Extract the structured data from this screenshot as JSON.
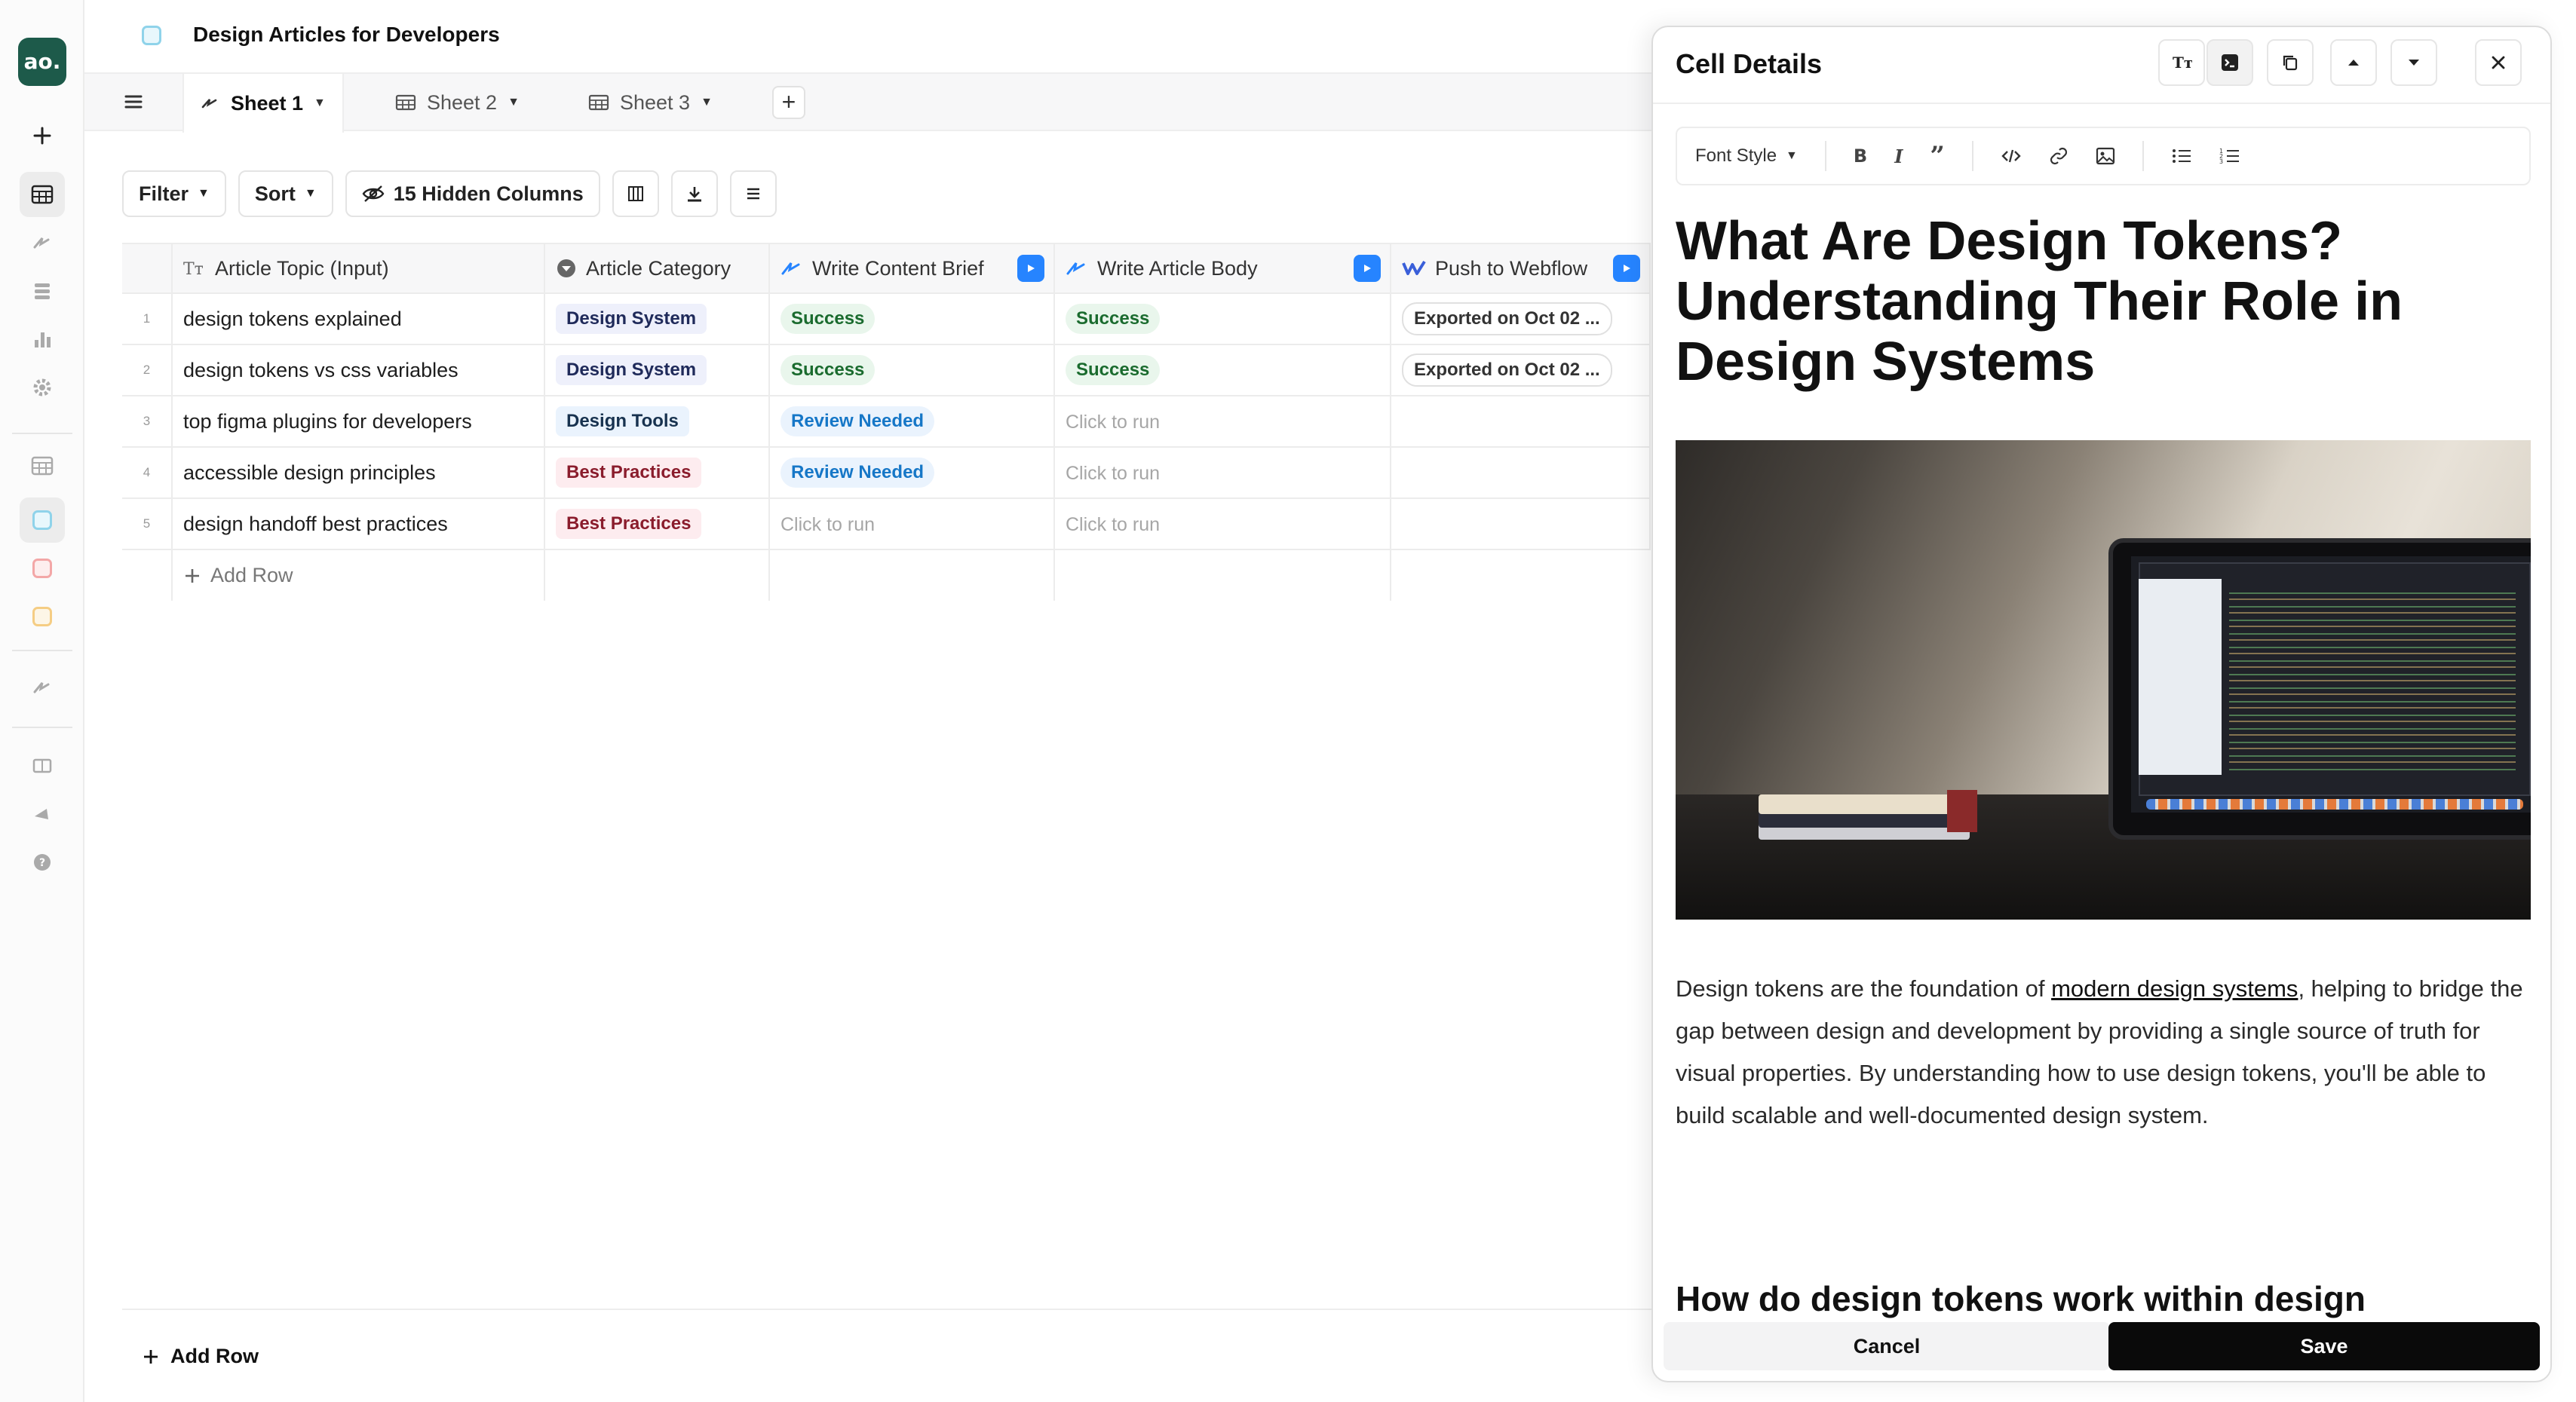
{
  "doc": {
    "title": "Design Articles for Developers"
  },
  "brand": {
    "logo_text": "ao.",
    "accent": "#1d5a4a"
  },
  "tabs": [
    {
      "label": "Sheet 1",
      "active": true
    },
    {
      "label": "Sheet 2",
      "active": false
    },
    {
      "label": "Sheet 3",
      "active": false
    }
  ],
  "toolbar": {
    "filter_label": "Filter",
    "sort_label": "Sort",
    "hidden_label": "15 Hidden Columns"
  },
  "grid": {
    "columns": [
      {
        "label": "Article Topic (Input)"
      },
      {
        "label": "Article Category"
      },
      {
        "label": "Write Content Brief"
      },
      {
        "label": "Write Article Body"
      },
      {
        "label": "Push to Webflow"
      }
    ],
    "rows": [
      {
        "n": "1",
        "topic": "design tokens explained",
        "category": "Design System",
        "brief": "Success",
        "body": "Success",
        "push": "Exported on Oct 02 ..."
      },
      {
        "n": "2",
        "topic": "design tokens vs css variables",
        "category": "Design System",
        "brief": "Success",
        "body": "Success",
        "push": "Exported on Oct 02 ..."
      },
      {
        "n": "3",
        "topic": "top figma plugins for developers",
        "category": "Design Tools",
        "brief": "Review Needed",
        "body": "Click to run",
        "push": ""
      },
      {
        "n": "4",
        "topic": "accessible design principles",
        "category": "Best Practices",
        "brief": "Review Needed",
        "body": "Click to run",
        "push": ""
      },
      {
        "n": "5",
        "topic": "design handoff best practices",
        "category": "Best Practices",
        "brief": "Click to run",
        "body": "Click to run",
        "push": ""
      }
    ],
    "add_row_label": "Add Row"
  },
  "footer": {
    "add_row_label": "Add Row"
  },
  "panel": {
    "title": "Cell Details",
    "font_style_label": "Font Style",
    "article_title": "What Are Design Tokens? Understanding Their Role in Design Systems",
    "para_before": "Design tokens are the foundation of ",
    "para_link": "modern design systems",
    "para_after": ", helping to bridge the gap between design and development by providing a single source of truth for visual properties. By understanding how to use design tokens, you'll be able to build scalable and well-documented design system.",
    "subheading": "How do design tokens work within design",
    "cancel_label": "Cancel",
    "save_label": "Save"
  },
  "colors": {
    "play_button": "#2684ff",
    "success_chip": "#1a6b2e",
    "review_chip": "#1677c7"
  }
}
